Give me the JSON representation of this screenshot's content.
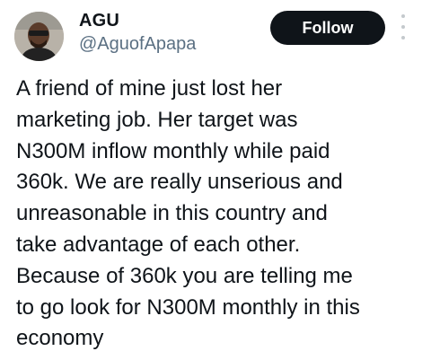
{
  "author": {
    "name": "AGU",
    "handle": "@AguofApapa",
    "avatar_icon": "profile-photo"
  },
  "actions": {
    "follow_label": "Follow",
    "more_icon": "more-vertical-icon"
  },
  "tweet": {
    "text": "A friend of mine just lost her\nmarketing job. Her target was\nN300M inflow monthly while paid\n360k. We are really unserious and\nunreasonable in this country and\ntake advantage of each other.\nBecause of 360k you are telling me\nto go look for N300M monthly in this\neconomy"
  },
  "colors": {
    "button_bg": "#0f1419",
    "handle": "#5b7083"
  }
}
